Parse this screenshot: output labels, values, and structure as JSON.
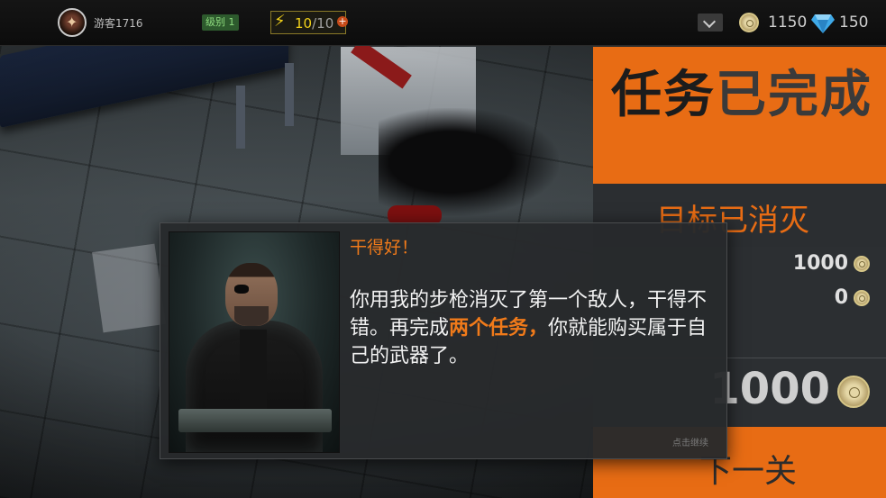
{
  "topbar": {
    "username": "游客1716",
    "level_label": "级别",
    "level_value": "1",
    "energy_current": "10",
    "energy_sep": "/",
    "energy_max": "10",
    "coins": "1150",
    "gems": "150"
  },
  "results": {
    "title_part1": "任务",
    "title_part2": "已完成",
    "target_status": "目标已消灭",
    "reward_1": "1000",
    "reward_2": "0",
    "total": "1000",
    "next_button": "下一关"
  },
  "dialog": {
    "title": "干得好！",
    "text_before": "你用我的步枪消灭了第一个敌人，干得不错。再完成",
    "text_highlight": "两个任务，",
    "text_after": "你就能购买属于自己的武器了。",
    "continue_hint": "点击继续"
  },
  "colors": {
    "accent_orange": "#e86c14",
    "energy_yellow": "#f2d21a",
    "gem_blue": "#3fa9e8"
  },
  "icons": [
    "avatar-icon",
    "bolt-icon",
    "plus-icon",
    "chevron-down-icon",
    "coin-icon",
    "gem-icon"
  ]
}
